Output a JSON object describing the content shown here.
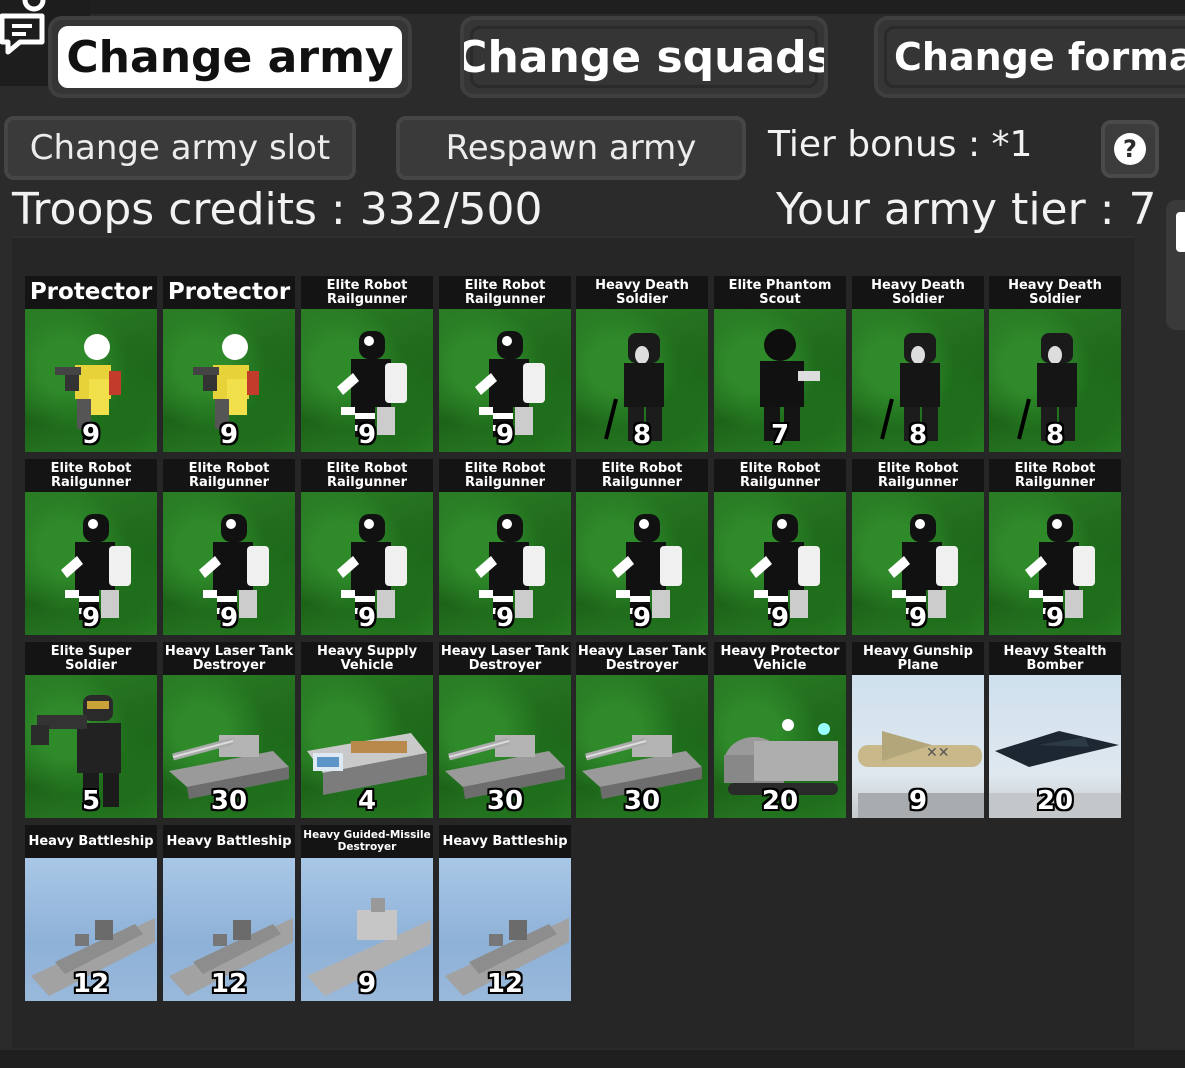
{
  "tabs": [
    {
      "label": "Change army",
      "active": true
    },
    {
      "label": "Change squads",
      "active": false
    },
    {
      "label": "Change formatio",
      "active": false
    }
  ],
  "actions": {
    "change_slot": "Change army slot",
    "respawn": "Respawn army",
    "tier_bonus": "Tier bonus : *1",
    "help": "?"
  },
  "stats": {
    "credits": "Troops credits : 332/500",
    "army_tier": "Your army tier : 7"
  },
  "units": [
    {
      "name": "Protector",
      "cost": "9",
      "kind": "protector"
    },
    {
      "name": "Protector",
      "cost": "9",
      "kind": "protector"
    },
    {
      "name": "Elite Robot Railgunner",
      "cost": "9",
      "kind": "robot"
    },
    {
      "name": "Elite Robot Railgunner",
      "cost": "9",
      "kind": "robot"
    },
    {
      "name": "Heavy Death Soldier",
      "cost": "8",
      "kind": "death"
    },
    {
      "name": "Elite Phantom Scout",
      "cost": "7",
      "kind": "phantom"
    },
    {
      "name": "Heavy Death Soldier",
      "cost": "8",
      "kind": "death"
    },
    {
      "name": "Heavy Death Soldier",
      "cost": "8",
      "kind": "death"
    },
    {
      "name": "Elite Robot Railgunner",
      "cost": "9",
      "kind": "robot"
    },
    {
      "name": "Elite Robot Railgunner",
      "cost": "9",
      "kind": "robot"
    },
    {
      "name": "Elite Robot Railgunner",
      "cost": "9",
      "kind": "robot"
    },
    {
      "name": "Elite Robot Railgunner",
      "cost": "9",
      "kind": "robot"
    },
    {
      "name": "Elite Robot Railgunner",
      "cost": "9",
      "kind": "robot"
    },
    {
      "name": "Elite Robot Railgunner",
      "cost": "9",
      "kind": "robot"
    },
    {
      "name": "Elite Robot Railgunner",
      "cost": "9",
      "kind": "robot"
    },
    {
      "name": "Elite Robot Railgunner",
      "cost": "9",
      "kind": "robot"
    },
    {
      "name": "Elite Super Soldier",
      "cost": "5",
      "kind": "super"
    },
    {
      "name": "Heavy Laser Tank Destroyer",
      "cost": "30",
      "kind": "tank"
    },
    {
      "name": "Heavy Supply Vehicle",
      "cost": "4",
      "kind": "supply"
    },
    {
      "name": "Heavy Laser Tank Destroyer",
      "cost": "30",
      "kind": "tank"
    },
    {
      "name": "Heavy Laser Tank Destroyer",
      "cost": "30",
      "kind": "tank"
    },
    {
      "name": "Heavy Protector Vehicle",
      "cost": "20",
      "kind": "protvehicle"
    },
    {
      "name": "Heavy Gunship Plane",
      "cost": "9",
      "kind": "gunship"
    },
    {
      "name": "Heavy Stealth Bomber",
      "cost": "20",
      "kind": "bomber"
    },
    {
      "name": "Heavy Battleship",
      "cost": "12",
      "kind": "battleship"
    },
    {
      "name": "Heavy Battleship",
      "cost": "12",
      "kind": "battleship"
    },
    {
      "name": "Heavy Guided-Missile Destroyer",
      "cost": "9",
      "kind": "destroyer"
    },
    {
      "name": "Heavy Battleship",
      "cost": "12",
      "kind": "battleship"
    }
  ]
}
